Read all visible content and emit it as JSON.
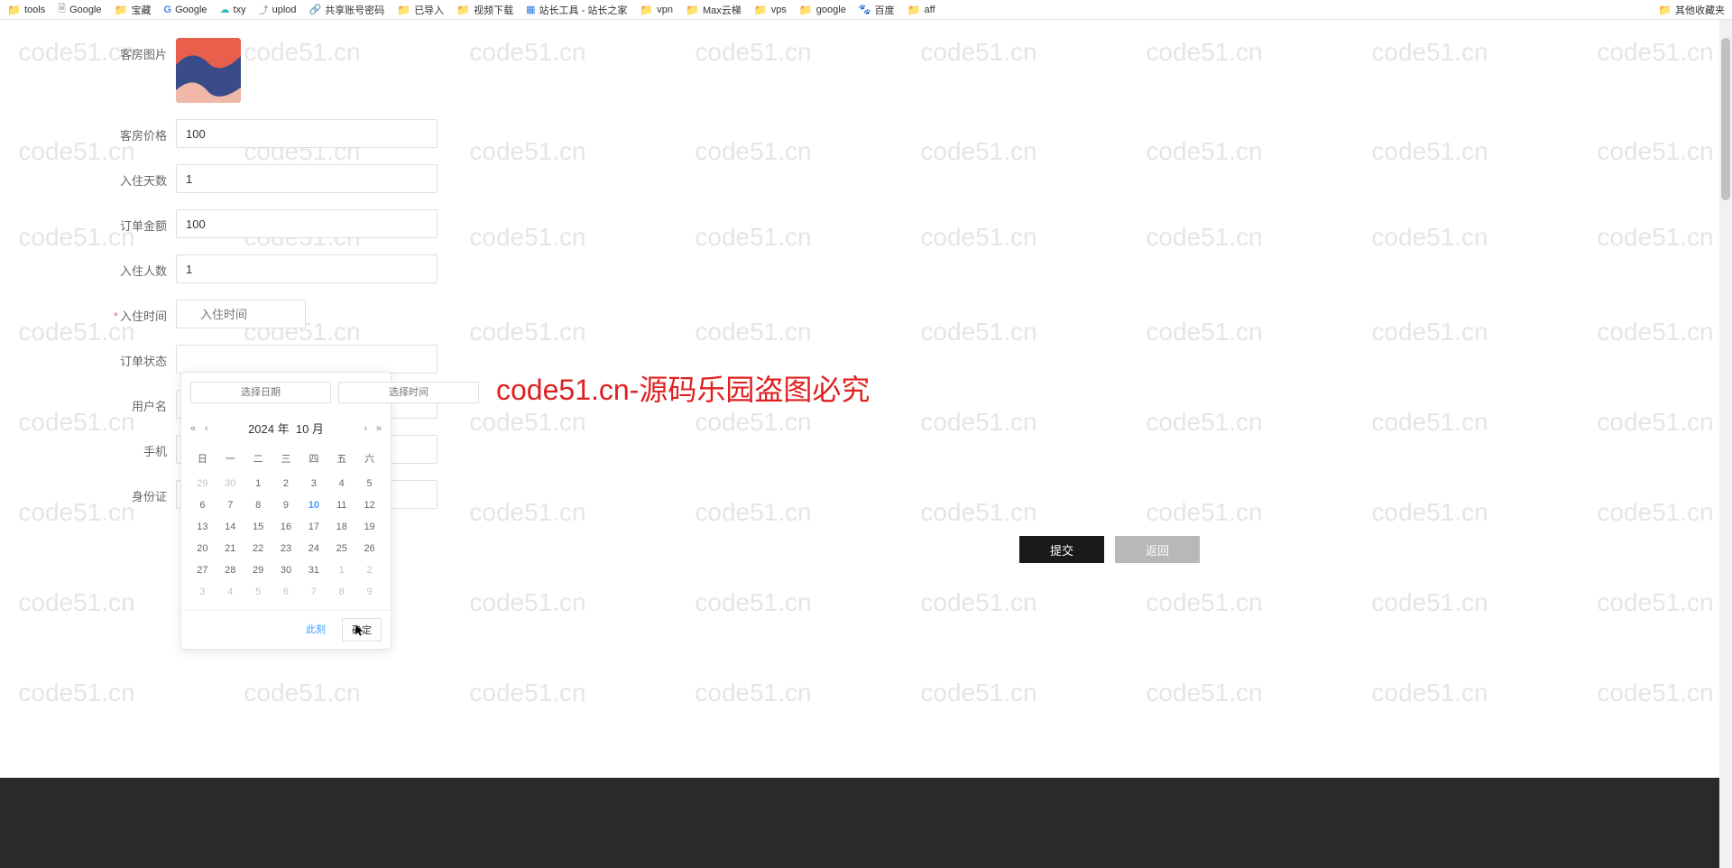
{
  "bookmarks": {
    "left": [
      {
        "icon": "folder",
        "label": "tools"
      },
      {
        "icon": "page",
        "label": "Google"
      },
      {
        "icon": "folder",
        "label": "宝藏"
      },
      {
        "icon": "gicon",
        "label": "Google"
      },
      {
        "icon": "cloud",
        "label": "txy"
      },
      {
        "icon": "upload",
        "label": "uplod"
      },
      {
        "icon": "share",
        "label": "共享账号密码"
      },
      {
        "icon": "folder",
        "label": "已导入"
      },
      {
        "icon": "folder",
        "label": "视频下载"
      },
      {
        "icon": "site",
        "label": "站长工具 - 站长之家"
      },
      {
        "icon": "folder",
        "label": "vpn"
      },
      {
        "icon": "folder",
        "label": "Max云梯"
      },
      {
        "icon": "folder",
        "label": "vps"
      },
      {
        "icon": "folder",
        "label": "google"
      },
      {
        "icon": "baidu",
        "label": "百度"
      },
      {
        "icon": "folder",
        "label": "aff"
      }
    ],
    "right": [
      {
        "icon": "folder",
        "label": "其他收藏夹"
      }
    ]
  },
  "watermark": {
    "text": "code51.cn",
    "big": "code51.cn-源码乐园盗图必究"
  },
  "form": {
    "room_image_label": "客房图片",
    "price_label": "客房价格",
    "price_value": "100",
    "days_label": "入住天数",
    "days_value": "1",
    "amount_label": "订单金额",
    "amount_value": "100",
    "people_label": "入住人数",
    "people_value": "1",
    "checkin_label": "入住时间",
    "checkin_placeholder": "入住时间",
    "status_label": "订单状态",
    "username_label": "用户名",
    "phone_label": "手机",
    "idcard_label": "身份证"
  },
  "datepicker": {
    "date_placeholder": "选择日期",
    "time_placeholder": "选择时间",
    "year_text": "2024 年",
    "month_text": "10 月",
    "weekdays": [
      "日",
      "一",
      "二",
      "三",
      "四",
      "五",
      "六"
    ],
    "weeks": [
      [
        {
          "d": "29",
          "o": true
        },
        {
          "d": "30",
          "o": true
        },
        {
          "d": "1"
        },
        {
          "d": "2"
        },
        {
          "d": "3"
        },
        {
          "d": "4"
        },
        {
          "d": "5"
        }
      ],
      [
        {
          "d": "6"
        },
        {
          "d": "7"
        },
        {
          "d": "8"
        },
        {
          "d": "9"
        },
        {
          "d": "10",
          "today": true
        },
        {
          "d": "11"
        },
        {
          "d": "12"
        }
      ],
      [
        {
          "d": "13"
        },
        {
          "d": "14"
        },
        {
          "d": "15"
        },
        {
          "d": "16"
        },
        {
          "d": "17"
        },
        {
          "d": "18"
        },
        {
          "d": "19"
        }
      ],
      [
        {
          "d": "20"
        },
        {
          "d": "21"
        },
        {
          "d": "22"
        },
        {
          "d": "23"
        },
        {
          "d": "24"
        },
        {
          "d": "25"
        },
        {
          "d": "26"
        }
      ],
      [
        {
          "d": "27"
        },
        {
          "d": "28"
        },
        {
          "d": "29"
        },
        {
          "d": "30"
        },
        {
          "d": "31"
        },
        {
          "d": "1",
          "o": true
        },
        {
          "d": "2",
          "o": true
        }
      ],
      [
        {
          "d": "3",
          "o": true
        },
        {
          "d": "4",
          "o": true
        },
        {
          "d": "5",
          "o": true
        },
        {
          "d": "6",
          "o": true
        },
        {
          "d": "7",
          "o": true
        },
        {
          "d": "8",
          "o": true
        },
        {
          "d": "9",
          "o": true
        }
      ]
    ],
    "now_btn": "此刻",
    "ok_btn": "确定"
  },
  "actions": {
    "submit": "提交",
    "back": "返回"
  }
}
